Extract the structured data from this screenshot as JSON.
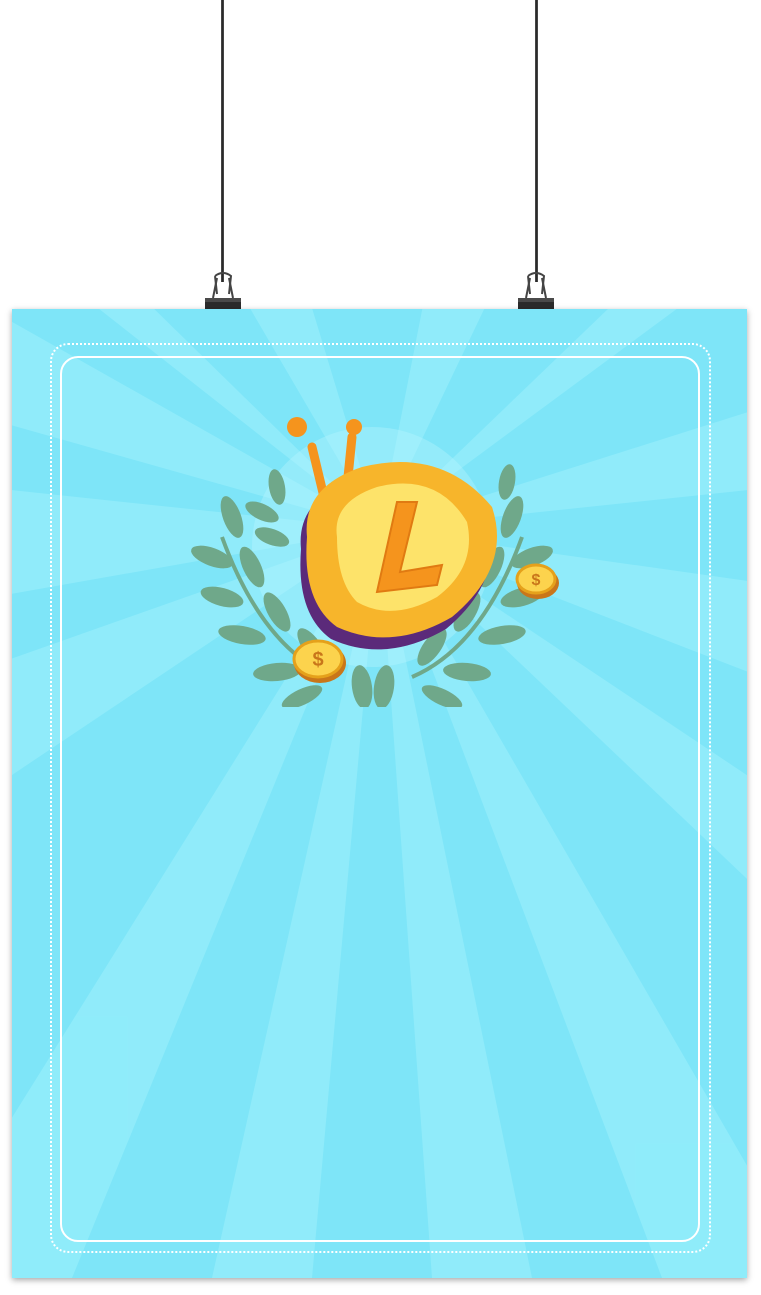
{
  "poster": {
    "background_color": "#7ee5f8",
    "ray_color": "#9af0fc",
    "frame_color": "#ffffff",
    "hanging": {
      "wire_color": "#333333",
      "clip_color": "#2b2b2b",
      "clip_count": 2
    },
    "emblem": {
      "icon": "coin-logo-icon",
      "letter": "L",
      "crown_color": "#f5941d",
      "coin_colors": [
        "#fcd34d",
        "#f5a623"
      ],
      "laurel_color": "#6fa88a",
      "small_coins": [
        "dollar-coin-icon",
        "dollar-coin-icon"
      ]
    }
  }
}
